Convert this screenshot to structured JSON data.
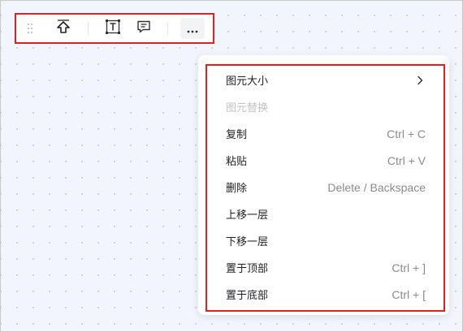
{
  "toolbar": {
    "icons": [
      "drag-handle-icon",
      "arrow-up-icon",
      "text-box-icon",
      "comment-icon",
      "more-icon"
    ]
  },
  "menu": {
    "items": [
      {
        "label": "图元大小",
        "shortcut": "",
        "submenu": true,
        "disabled": false
      },
      {
        "label": "图元替换",
        "shortcut": "",
        "submenu": false,
        "disabled": true
      },
      {
        "label": "复制",
        "shortcut": "Ctrl + C",
        "submenu": false,
        "disabled": false
      },
      {
        "label": "粘贴",
        "shortcut": "Ctrl + V",
        "submenu": false,
        "disabled": false
      },
      {
        "label": "删除",
        "shortcut": "Delete / Backspace",
        "submenu": false,
        "disabled": false
      },
      {
        "label": "上移一层",
        "shortcut": "",
        "submenu": false,
        "disabled": false
      },
      {
        "label": "下移一层",
        "shortcut": "",
        "submenu": false,
        "disabled": false
      },
      {
        "label": "置于顶部",
        "shortcut": "Ctrl + ]",
        "submenu": false,
        "disabled": false
      },
      {
        "label": "置于底部",
        "shortcut": "Ctrl + [",
        "submenu": false,
        "disabled": false
      }
    ]
  },
  "colors": {
    "highlight_border": "#e02020",
    "canvas_background": "#f2f6fc",
    "text": "#1f1f1f",
    "disabled_text": "#c2c2c2",
    "shortcut_text": "#8a8a8a"
  }
}
